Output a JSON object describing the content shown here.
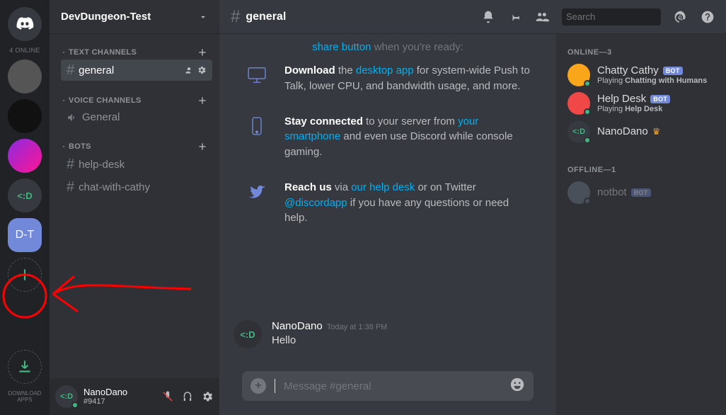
{
  "rail": {
    "online_label": "4 ONLINE",
    "servers": [
      {
        "id": "home",
        "glyph": "discord"
      },
      {
        "id": "s1",
        "glyph": "img"
      },
      {
        "id": "s2",
        "glyph": "img"
      },
      {
        "id": "s3",
        "glyph": "img"
      },
      {
        "id": "s4",
        "glyph": "code",
        "text": "<:D"
      },
      {
        "id": "s5",
        "glyph": "text",
        "text": "D-T",
        "selected": true
      }
    ],
    "add_server_tooltip": "Add a Server",
    "download_label": "DOWNLOAD APPS"
  },
  "sidebar": {
    "server_name": "DevDungeon-Test",
    "groups": [
      {
        "name": "TEXT CHANNELS",
        "add": true,
        "channels": [
          {
            "name": "general",
            "type": "text",
            "selected": true
          }
        ]
      },
      {
        "name": "VOICE CHANNELS",
        "add": true,
        "channels": [
          {
            "name": "General",
            "type": "voice"
          }
        ]
      },
      {
        "name": "BOTS",
        "add": true,
        "channels": [
          {
            "name": "help-desk",
            "type": "text"
          },
          {
            "name": "chat-with-cathy",
            "type": "text"
          }
        ]
      }
    ],
    "user": {
      "name": "NanoDano",
      "tag": "#9417"
    }
  },
  "topbar": {
    "channel": "general",
    "search_placeholder": "Search"
  },
  "welcome": {
    "truncated_link": "share button",
    "truncated_tail": " when you're ready:",
    "rows": [
      {
        "icon": "monitor",
        "bold": "Download",
        "tail1": " the ",
        "link1": "desktop app",
        "tail2": " for system-wide Push to Talk, lower CPU, and bandwidth usage, and more."
      },
      {
        "icon": "phone",
        "bold": "Stay connected",
        "tail1": " to your server from ",
        "link1": "your smartphone",
        "tail2": " and even use Discord while console gaming."
      },
      {
        "icon": "twitter",
        "bold": "Reach us",
        "tail1": " via ",
        "link1": "our help desk",
        "tail2": " or on Twitter ",
        "link2": "@discordapp",
        "tail3": " if you have any questions or need help."
      }
    ]
  },
  "message": {
    "author": "NanoDano",
    "timestamp": "Today at 1:38 PM",
    "body": "Hello"
  },
  "input": {
    "placeholder": "Message #general"
  },
  "members": {
    "groups": [
      {
        "label": "ONLINE—3",
        "items": [
          {
            "name": "Chatty Cathy",
            "bot": true,
            "activity_prefix": "Playing ",
            "activity": "Chatting with Humans",
            "status": "#43b581",
            "avatar": "#faa61a"
          },
          {
            "name": "Help Desk",
            "bot": true,
            "activity_prefix": "Playing ",
            "activity": "Help Desk",
            "status": "#43b581",
            "avatar": "#f04747"
          },
          {
            "name": "NanoDano",
            "bot": false,
            "owner": true,
            "status": "#43b581",
            "avatar": "#36393f",
            "glyph": "<:D"
          }
        ]
      },
      {
        "label": "OFFLINE—1",
        "items": [
          {
            "name": "notbot",
            "bot": true,
            "status": "#747f8d",
            "avatar": "#747f8d",
            "offline": true
          }
        ]
      }
    ]
  }
}
